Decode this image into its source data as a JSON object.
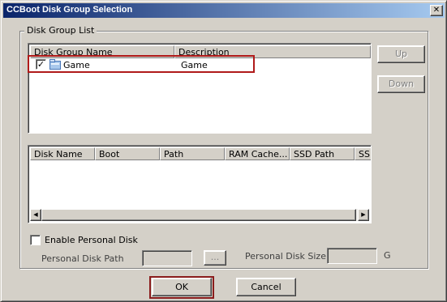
{
  "window": {
    "title": "CCBoot Disk Group Selection",
    "close_glyph": "✕"
  },
  "group": {
    "legend": "Disk Group List"
  },
  "disk_group_list": {
    "columns": [
      "Disk Group Name",
      "Description"
    ],
    "rows": [
      {
        "checked": true,
        "check_glyph": "✓",
        "icon": "disk-group-icon",
        "name": "Game",
        "description": "Game"
      }
    ]
  },
  "disk_list": {
    "columns": [
      "Disk Name",
      "Boot",
      "Path",
      "RAM Cache...",
      "SSD Path",
      "SSD"
    ],
    "rows": [],
    "scroll_left_glyph": "◀",
    "scroll_right_glyph": "▶"
  },
  "buttons": {
    "up": "Up",
    "down": "Down",
    "ok": "OK",
    "cancel": "Cancel",
    "browse": "..."
  },
  "personal_disk": {
    "enable_label": "Enable Personal Disk",
    "enabled": false,
    "path_label": "Personal Disk Path",
    "path_value": "",
    "size_label": "Personal Disk Size",
    "size_value": "",
    "size_unit": "G"
  },
  "colors": {
    "title_bar_start": "#0a246a",
    "title_bar_end": "#a6caf0",
    "highlight": "#b01a1a",
    "dialog_background": "#d4d0c8"
  }
}
